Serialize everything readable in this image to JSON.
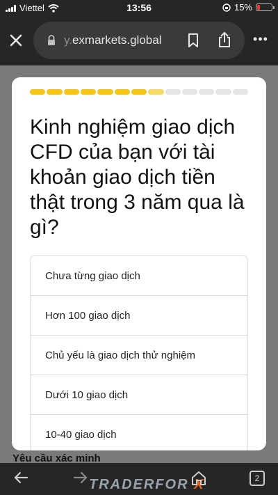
{
  "status_bar": {
    "carrier": "Viettel",
    "time": "13:56",
    "battery_percent": "15%",
    "battery_color": "#e33b30"
  },
  "browser": {
    "url_faded": "y.",
    "url_main": "exmarkets.global",
    "close_icon": "close-icon",
    "more_label": "•••"
  },
  "modal": {
    "progress": {
      "total_segments": 13,
      "completed_segments": 7,
      "partial_segments": 1,
      "fill_color": "#f5c518"
    },
    "question": "Kinh nghiệm giao dịch CFD của bạn với tài khoản giao dịch tiền thật trong 3 năm qua là gì?",
    "options": [
      "Chưa từng giao dịch",
      "Hơn 100 giao dịch",
      "Chủ yếu là giao dịch thử nghiệm",
      "Dưới 10 giao dịch",
      "10-40 giao dịch"
    ]
  },
  "background_page": {
    "text": "Yêu cầu xác minh"
  },
  "bottom_bar": {
    "tab_count": "2",
    "watermark_main": "TRADERFOR",
    "watermark_accent": "X"
  }
}
